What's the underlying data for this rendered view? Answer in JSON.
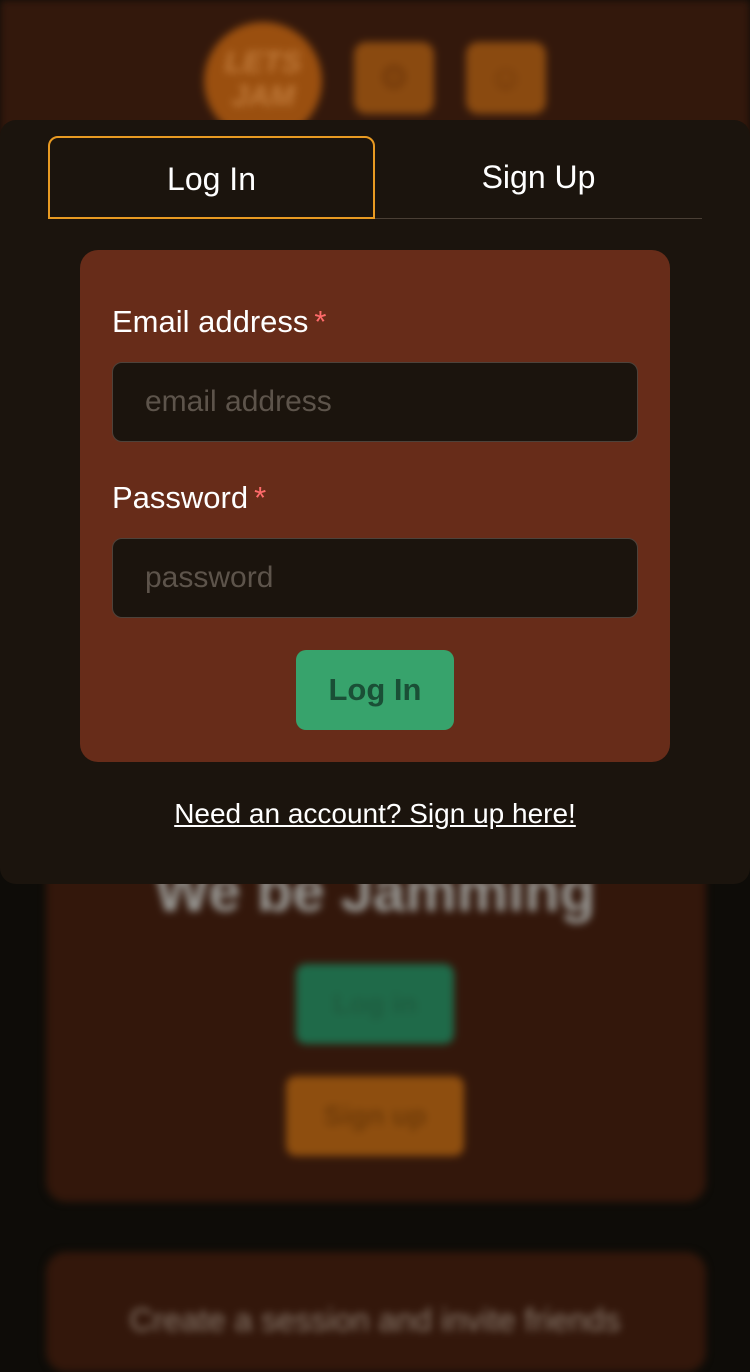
{
  "background": {
    "logo_text": "LETS JAM",
    "hero_title": "We be Jamming",
    "login_label": "Log in",
    "signup_label": "Sign up",
    "tagline": "Create a session and invite friends"
  },
  "modal": {
    "tabs": [
      {
        "label": "Log In",
        "active": true
      },
      {
        "label": "Sign Up",
        "active": false
      }
    ],
    "form": {
      "email": {
        "label": "Email address",
        "required_mark": "*",
        "placeholder": "email address",
        "value": ""
      },
      "password": {
        "label": "Password",
        "required_mark": "*",
        "placeholder": "password",
        "value": ""
      },
      "submit_label": "Log In"
    },
    "switch_link": "Need an account? Sign up here!"
  },
  "colors": {
    "accent": "#e89a22",
    "primary_button": "#37a36c",
    "form_card": "#672c19",
    "modal_bg": "#1b140d",
    "required": "#ff6b6b"
  }
}
